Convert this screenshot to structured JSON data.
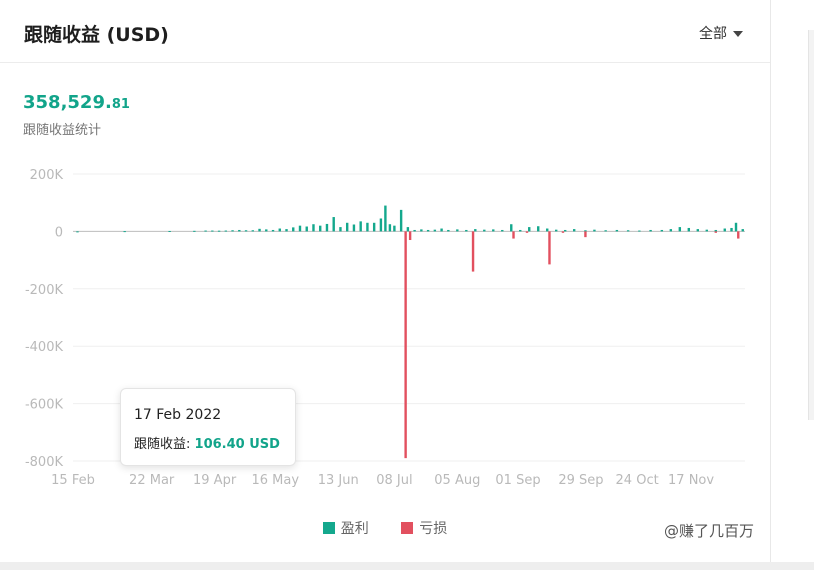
{
  "header": {
    "title": "跟随收益 (USD)",
    "filter_label": "全部"
  },
  "summary": {
    "total_int": "358,529.",
    "total_dec": "81",
    "label": "跟随收益统计"
  },
  "colors": {
    "profit": "#14a88d",
    "loss": "#e2505f",
    "grid": "#efefef",
    "axis_text": "#b9b9b9"
  },
  "tooltip": {
    "date": "17 Feb 2022",
    "label": "跟随收益:",
    "value": "106.40 USD"
  },
  "legend": {
    "profit": "盈利",
    "loss": "亏损"
  },
  "watermark": {
    "text": "@赚了几百万"
  },
  "chart_data": {
    "type": "bar",
    "ylim": [
      -800000,
      200000
    ],
    "y_ticks": [
      200000,
      0,
      -200000,
      -400000,
      -600000,
      -800000
    ],
    "y_tick_labels": [
      "200K",
      "0",
      "-200K",
      "-400K",
      "-600K",
      "-800K"
    ],
    "x_range": [
      "2022-02-15",
      "2022-12-11"
    ],
    "x_ticks": [
      "2022-02-15",
      "2022-03-22",
      "2022-04-19",
      "2022-05-16",
      "2022-06-13",
      "2022-07-08",
      "2022-08-05",
      "2022-09-01",
      "2022-09-29",
      "2022-10-24",
      "2022-11-17"
    ],
    "x_tick_labels": [
      "15 Feb",
      "22 Mar",
      "19 Apr",
      "16 May",
      "13 Jun",
      "08 Jul",
      "05 Aug",
      "01 Sep",
      "29 Sep",
      "24 Oct",
      "17 Nov"
    ],
    "grid": true,
    "legend_position": "bottom",
    "series": [
      {
        "name": "盈利",
        "points": [
          [
            "2022-02-17",
            106.4
          ],
          [
            "2022-03-10",
            1000
          ],
          [
            "2022-03-30",
            1500
          ],
          [
            "2022-04-10",
            2000
          ],
          [
            "2022-04-15",
            3000
          ],
          [
            "2022-04-18",
            3000
          ],
          [
            "2022-04-21",
            2500
          ],
          [
            "2022-04-24",
            3000
          ],
          [
            "2022-04-27",
            4000
          ],
          [
            "2022-04-30",
            5000
          ],
          [
            "2022-05-03",
            4000
          ],
          [
            "2022-05-06",
            4000
          ],
          [
            "2022-05-09",
            9000
          ],
          [
            "2022-05-12",
            7000
          ],
          [
            "2022-05-15",
            5000
          ],
          [
            "2022-05-18",
            10000
          ],
          [
            "2022-05-21",
            8000
          ],
          [
            "2022-05-24",
            14000
          ],
          [
            "2022-05-27",
            20000
          ],
          [
            "2022-05-30",
            17000
          ],
          [
            "2022-06-02",
            25000
          ],
          [
            "2022-06-05",
            20000
          ],
          [
            "2022-06-08",
            26000
          ],
          [
            "2022-06-11",
            50000
          ],
          [
            "2022-06-14",
            15000
          ],
          [
            "2022-06-17",
            30000
          ],
          [
            "2022-06-20",
            24000
          ],
          [
            "2022-06-23",
            35000
          ],
          [
            "2022-06-26",
            30000
          ],
          [
            "2022-06-29",
            30000
          ],
          [
            "2022-07-02",
            45000
          ],
          [
            "2022-07-04",
            90000
          ],
          [
            "2022-07-06",
            25000
          ],
          [
            "2022-07-08",
            20000
          ],
          [
            "2022-07-11",
            75000
          ],
          [
            "2022-07-14",
            15000
          ],
          [
            "2022-07-17",
            5000
          ],
          [
            "2022-07-20",
            7000
          ],
          [
            "2022-07-23",
            5000
          ],
          [
            "2022-07-26",
            6000
          ],
          [
            "2022-07-29",
            10000
          ],
          [
            "2022-08-01",
            5000
          ],
          [
            "2022-08-05",
            7000
          ],
          [
            "2022-08-09",
            5000
          ],
          [
            "2022-08-13",
            8000
          ],
          [
            "2022-08-17",
            6000
          ],
          [
            "2022-08-21",
            7000
          ],
          [
            "2022-08-25",
            5000
          ],
          [
            "2022-08-29",
            25000
          ],
          [
            "2022-09-02",
            5000
          ],
          [
            "2022-09-06",
            15000
          ],
          [
            "2022-09-10",
            18000
          ],
          [
            "2022-09-14",
            10000
          ],
          [
            "2022-09-18",
            6000
          ],
          [
            "2022-09-22",
            5000
          ],
          [
            "2022-09-26",
            8000
          ],
          [
            "2022-10-01",
            4000
          ],
          [
            "2022-10-05",
            6000
          ],
          [
            "2022-10-10",
            4000
          ],
          [
            "2022-10-15",
            5000
          ],
          [
            "2022-10-20",
            4000
          ],
          [
            "2022-10-25",
            3000
          ],
          [
            "2022-10-30",
            5000
          ],
          [
            "2022-11-04",
            5000
          ],
          [
            "2022-11-08",
            8000
          ],
          [
            "2022-11-12",
            15000
          ],
          [
            "2022-11-16",
            12000
          ],
          [
            "2022-11-20",
            8000
          ],
          [
            "2022-11-24",
            6000
          ],
          [
            "2022-11-28",
            5000
          ],
          [
            "2022-12-02",
            10000
          ],
          [
            "2022-12-05",
            12000
          ],
          [
            "2022-12-07",
            30000
          ],
          [
            "2022-12-10",
            8000
          ]
        ]
      },
      {
        "name": "亏损",
        "points": [
          [
            "2022-07-13",
            -790000
          ],
          [
            "2022-07-15",
            -30000
          ],
          [
            "2022-08-12",
            -140000
          ],
          [
            "2022-08-30",
            -25000
          ],
          [
            "2022-09-05",
            -5000
          ],
          [
            "2022-09-15",
            -115000
          ],
          [
            "2022-09-21",
            -5000
          ],
          [
            "2022-10-01",
            -20000
          ],
          [
            "2022-11-28",
            -5000
          ],
          [
            "2022-12-08",
            -25000
          ]
        ]
      }
    ]
  }
}
